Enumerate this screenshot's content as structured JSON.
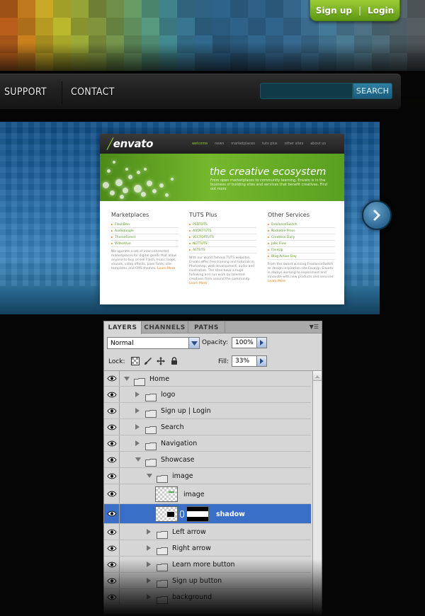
{
  "auth": {
    "signup_label": "Sign up",
    "separator": "|",
    "login_label": "Login"
  },
  "nav": {
    "support_label": "SUPPORT",
    "contact_label": "CONTACT",
    "search_button_label": "SEARCH"
  },
  "mosaic_colors": [
    "#b05a1a",
    "#c07a1c",
    "#b79a22",
    "#a9a729",
    "#8f9b33",
    "#7a8c3a",
    "#6f8f48",
    "#5f8e5c",
    "#4f8b73",
    "#3d7e84",
    "#346f8a",
    "#2f6384",
    "#2a5a7e",
    "#2b597c",
    "#2c5c7f",
    "#2f5f84",
    "#356489",
    "#3a6a8c",
    "#3f6e8b",
    "#446f86",
    "#496d7f",
    "#4b6774",
    "#4d5f66",
    "#4f5558"
  ],
  "showcase": {
    "brand": "envato",
    "top_nav": [
      "welcome",
      "news",
      "marketplaces",
      "tuts plus",
      "other sites",
      "about us"
    ],
    "hero_title": "the creative ecosystem",
    "hero_desc": "From open marketplaces to community learning, Envato is in the business of building sites and services that benefit creatives. Find out more",
    "columns": [
      {
        "title": "Marketplaces",
        "items": [
          "FlashDen",
          "AudioJungle",
          "ThemeForest",
          "VideoHive"
        ],
        "desc": "We operate a set of inter-connected marketplaces for digital goods that allow anyone to buy or sell Flash, music loops, sounds, video effects, pixel fonts, site templates and CMS themes.",
        "more": "Learn More"
      },
      {
        "title": "TUTS Plus",
        "items": [
          "PSDTUTS",
          "AUDIOTUTS",
          "VECTORTUTS",
          "NETTUTS",
          "AETUTS"
        ],
        "desc": "With our world famous TUTS websites, Envato offer free training and tutorials in Photoshop, web development, audio and illustration. The sites have a huge following and run work by talented creatives from around the community.",
        "more": "Learn More"
      },
      {
        "title": "Other Services",
        "items": [
          "FreelanceSwitch",
          "Rockable Press",
          "Creattica Daily",
          "Jobs Flow",
          "FaveUp",
          "Blog Action Day"
        ],
        "desc": "From the award winning FreelanceSwitch to design inspiration site FaveUp, Envato is always working to experiment and innovate with new products and services.",
        "more": "Learn More"
      }
    ]
  },
  "panel": {
    "tabs": [
      "LAYERS",
      "CHANNELS",
      "PATHS"
    ],
    "blend_mode": "Normal",
    "opacity_label": "Opacity:",
    "opacity_value": "100%",
    "lock_label": "Lock:",
    "fill_label": "Fill:",
    "fill_value": "33%",
    "layers": [
      {
        "name": "Home"
      },
      {
        "name": "logo"
      },
      {
        "name": "Sign up   |   Login"
      },
      {
        "name": "Search"
      },
      {
        "name": "Navigation"
      },
      {
        "name": "Showcase"
      },
      {
        "name": "image"
      },
      {
        "name": "image"
      },
      {
        "name": "shadow"
      },
      {
        "name": "Left arrow"
      },
      {
        "name": "Right arrow"
      },
      {
        "name": "Learn more button"
      },
      {
        "name": "Sign up  button"
      },
      {
        "name": "background"
      }
    ]
  }
}
